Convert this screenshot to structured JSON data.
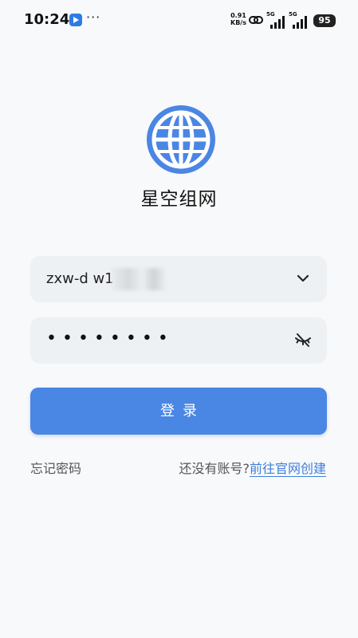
{
  "status_bar": {
    "time": "10:24",
    "more": "···",
    "speed_value": "0.91",
    "speed_unit": "KB/s",
    "network_1": "5G",
    "network_2": "5G",
    "battery": "95"
  },
  "app": {
    "logo_icon": "globe-icon",
    "title": "星空组网"
  },
  "form": {
    "username_value": "zxw-d  w113",
    "username_dropdown_icon": "chevron-down-icon",
    "password_value": "••••••••",
    "password_toggle_icon": "eye-off-icon",
    "login_label": "登录"
  },
  "footer": {
    "forgot_password": "忘记密码",
    "no_account_prompt": "还没有账号?",
    "signup_link": "前往官网创建"
  },
  "colors": {
    "accent": "#4a86e4",
    "link": "#3f7fdc",
    "field_bg": "#eef1f4"
  }
}
